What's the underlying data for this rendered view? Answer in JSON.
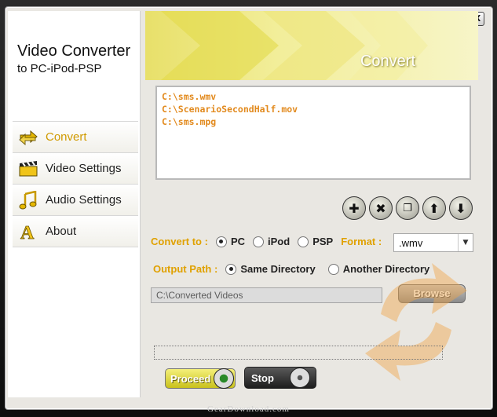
{
  "window": {
    "controls": [
      "?",
      "↙",
      "X"
    ]
  },
  "sidebar": {
    "app_title_line1": "Video Converter",
    "app_title_line2": "to PC-iPod-PSP",
    "items": [
      {
        "label": "Convert",
        "icon": "convert-arrows-icon",
        "active": true
      },
      {
        "label": "Video Settings",
        "icon": "clapperboard-icon",
        "active": false
      },
      {
        "label": "Audio Settings",
        "icon": "music-note-icon",
        "active": false
      },
      {
        "label": "About",
        "icon": "letter-a-icon",
        "active": false
      }
    ]
  },
  "header": {
    "title": "Convert"
  },
  "files": [
    "C:\\sms.wmv",
    "C:\\ScenarioSecondHalf.mov",
    "C:\\sms.mpg"
  ],
  "file_actions": [
    "add-icon",
    "remove-icon",
    "copy-icon",
    "move-up-icon",
    "move-down-icon"
  ],
  "convert_to": {
    "label": "Convert to :",
    "options": [
      "PC",
      "iPod",
      "PSP"
    ],
    "selected": "PC"
  },
  "format": {
    "label": "Format :",
    "value": ".wmv"
  },
  "output_path": {
    "label": "Output Path :",
    "options": [
      "Same Directory",
      "Another Directory"
    ],
    "selected": "Same Directory",
    "path_value": "C:\\Converted Videos",
    "browse_label": "Browse"
  },
  "actions": {
    "proceed_label": "Proceed",
    "stop_label": "Stop"
  },
  "footer": {
    "watermark": "GearDownload.com"
  },
  "colors": {
    "accent": "#e0a100",
    "file_text": "#e28a1e",
    "header_bg": "#ece57a"
  }
}
